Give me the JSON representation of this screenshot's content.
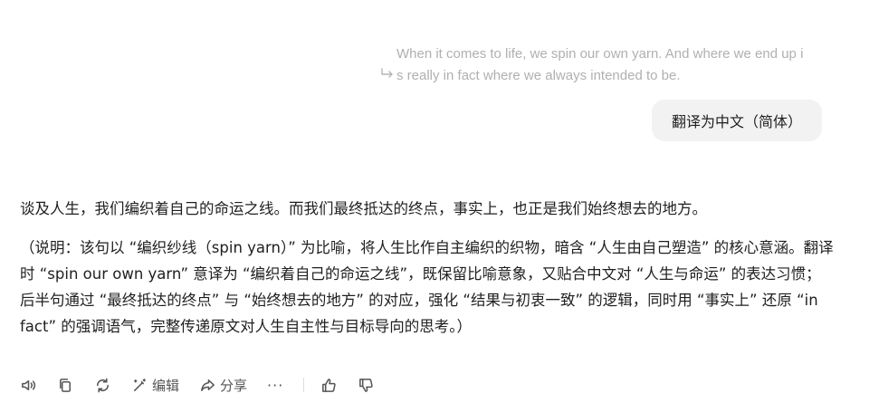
{
  "quote": {
    "text": "When it comes to life, we spin our own yarn. And where we end up is really in fact where we always intended to be."
  },
  "user_message": "翻译为中文（简体）",
  "answer": {
    "translation": "谈及人生，我们编织着自己的命运之线。而我们最终抵达的终点，事实上，也正是我们始终想去的地方。",
    "note": "（说明：该句以 “编织纱线（spin yarn）” 为比喻，将人生比作自主编织的织物，暗含 “人生由自己塑造” 的核心意涵。翻译时 “spin our own yarn” 意译为 “编织着自己的命运之线”，既保留比喻意象，又贴合中文对 “人生与命运” 的表达习惯；后半句通过 “最终抵达的终点” 与 “始终想去的地方” 的对应，强化 “结果与初衷一致” 的逻辑，同时用 “事实上” 还原 “in fact” 的强调语气，完整传递原文对人生自主性与目标导向的思考。）"
  },
  "actions": {
    "edit_label": "编辑",
    "share_label": "分享",
    "more_label": "···"
  }
}
